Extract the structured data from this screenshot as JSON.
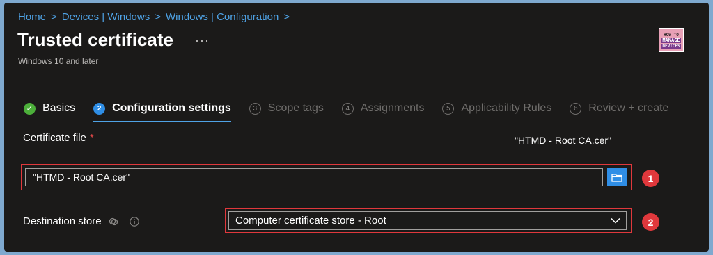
{
  "breadcrumb": {
    "items": [
      "Home",
      "Devices | Windows",
      "Windows | Configuration"
    ],
    "separator": ">"
  },
  "page": {
    "title": "Trusted certificate",
    "subtitle": "Windows 10 and later",
    "more_label": "···",
    "logo": {
      "line1": "HOW TO",
      "line2": "MANAGE",
      "line3": "DEVICES",
      "color": "#e8a0b6"
    }
  },
  "tabs": [
    {
      "step": "✓",
      "label": "Basics",
      "state": "done"
    },
    {
      "step": "2",
      "label": "Configuration settings",
      "state": "active"
    },
    {
      "step": "3",
      "label": "Scope tags",
      "state": "pending"
    },
    {
      "step": "4",
      "label": "Assignments",
      "state": "pending"
    },
    {
      "step": "5",
      "label": "Applicability Rules",
      "state": "pending"
    },
    {
      "step": "6",
      "label": "Review + create",
      "state": "pending"
    }
  ],
  "certificate": {
    "label": "Certificate file",
    "required_marker": "*",
    "selected_filename": "\"HTMD - Root CA.cer\"",
    "input_value": "\"HTMD - Root CA.cer\"",
    "browse_icon": "folder-icon"
  },
  "destination": {
    "label": "Destination store",
    "selected_value": "Computer certificate store - Root",
    "icons": [
      "sync-icon",
      "info-icon"
    ]
  },
  "annotations": {
    "badge1": "1",
    "badge2": "2",
    "color": "#e0383c"
  },
  "colors": {
    "accent": "#2f8ee6",
    "link": "#4fa3e6",
    "success": "#4caf3a",
    "background": "#1b1a19"
  }
}
